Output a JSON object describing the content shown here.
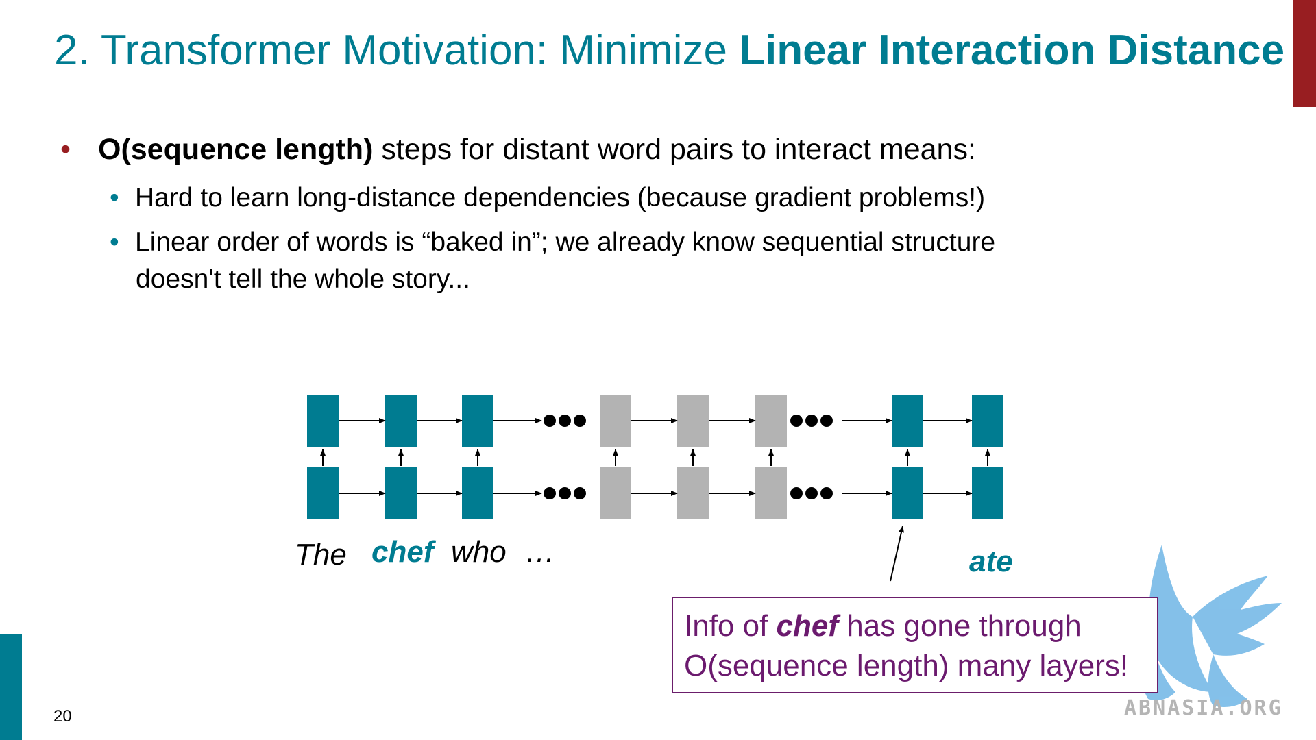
{
  "slide": {
    "title_prefix": "2. Transformer Motivation: Minimize ",
    "title_bold": "Linear Interaction Distance",
    "page_number": "20"
  },
  "bullets": {
    "main_bold": "O(sequence length)",
    "main_rest": " steps for distant word pairs to interact means:",
    "sub1": "Hard to learn long-distance dependencies (because gradient problems!)",
    "sub2_line1": "Linear order of words is “baked in”; we already know sequential structure",
    "sub2_line2": "doesn't tell the whole story..."
  },
  "diagram": {
    "words": {
      "the": "The",
      "chef": "chef",
      "who": "who",
      "ellipsis": "…",
      "ate": "ate"
    },
    "colors": {
      "teal": "#007c91",
      "gray": "#b3b3b3",
      "arrow": "#000000"
    },
    "callout": {
      "prefix": "Info of ",
      "emph": "chef",
      "suffix": " has gone through",
      "line2": "O(sequence length) many layers!"
    }
  },
  "watermark": {
    "text": "ABNASIA.ORG"
  }
}
